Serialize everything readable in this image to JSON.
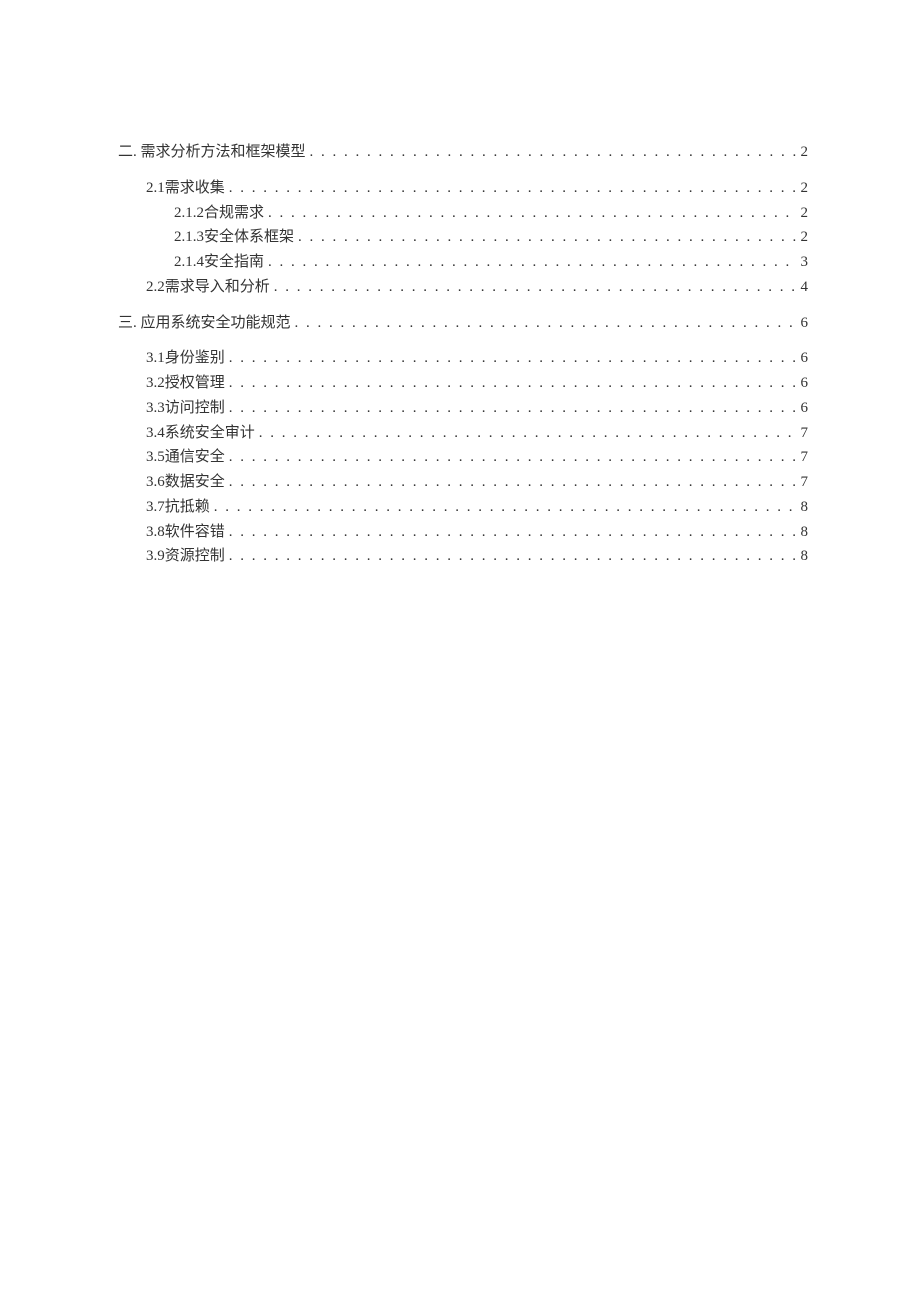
{
  "toc": {
    "entries": [
      {
        "level": 0,
        "title": "二. 需求分析方法和框架模型",
        "page": "2",
        "gapAfter": true
      },
      {
        "level": 1,
        "title": "2.1需求收集",
        "page": "2"
      },
      {
        "level": 2,
        "title": "2.1.2合规需求",
        "page": "2"
      },
      {
        "level": 2,
        "title": "2.1.3安全体系框架",
        "page": "2"
      },
      {
        "level": 2,
        "title": "2.1.4安全指南",
        "page": "3"
      },
      {
        "level": 1,
        "title": "2.2需求导入和分析",
        "page": "4",
        "gapAfter": true
      },
      {
        "level": 0,
        "title": "三. 应用系统安全功能规范",
        "page": "6",
        "gapAfter": true
      },
      {
        "level": 1,
        "title": "3.1身份鉴别",
        "page": "6"
      },
      {
        "level": 1,
        "title": "3.2授权管理",
        "page": "6"
      },
      {
        "level": 1,
        "title": "3.3访问控制",
        "page": "6"
      },
      {
        "level": 1,
        "title": "3.4系统安全审计",
        "page": "7"
      },
      {
        "level": 1,
        "title": "3.5通信安全",
        "page": "7"
      },
      {
        "level": 1,
        "title": "3.6数据安全",
        "page": "7"
      },
      {
        "level": 1,
        "title": "3.7抗抵赖",
        "page": "8"
      },
      {
        "level": 1,
        "title": "3.8软件容错",
        "page": "8"
      },
      {
        "level": 1,
        "title": "3.9资源控制",
        "page": "8"
      }
    ]
  }
}
